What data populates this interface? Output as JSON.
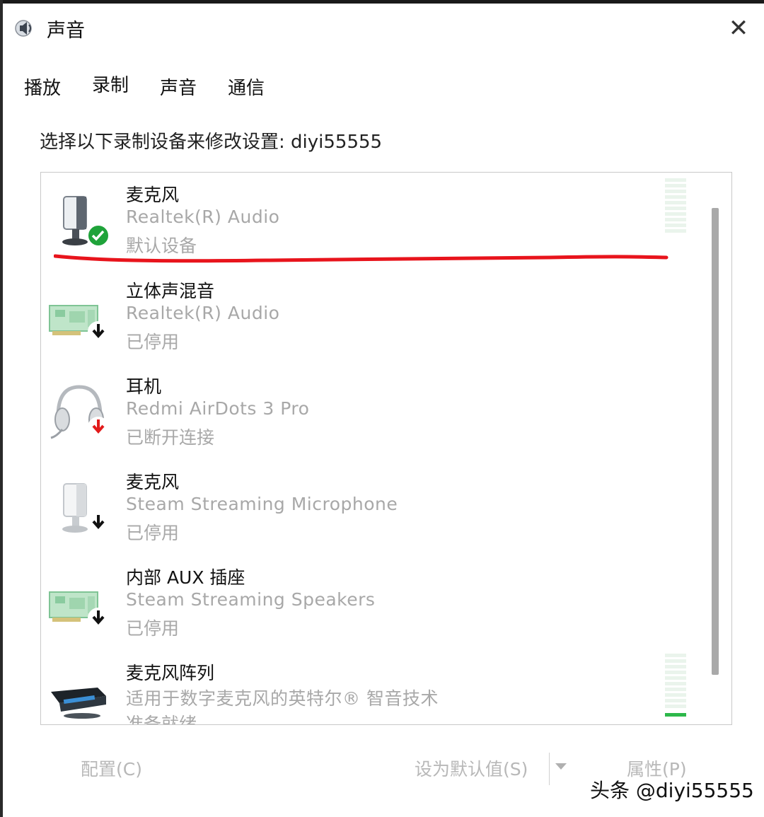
{
  "window": {
    "title": "声音"
  },
  "tabs": [
    {
      "label": "播放"
    },
    {
      "label": "录制"
    },
    {
      "label": "声音"
    },
    {
      "label": "通信"
    }
  ],
  "instruction": "选择以下录制设备来修改设置: diyi55555",
  "devices": [
    {
      "name": "麦克风",
      "driver": "Realtek(R) Audio",
      "status": "默认设备",
      "icon": "microphone-icon",
      "badge": "default-check-icon"
    },
    {
      "name": "立体声混音",
      "driver": "Realtek(R) Audio",
      "status": "已停用",
      "icon": "sound-card-icon",
      "badge": "disabled-arrow-icon"
    },
    {
      "name": "耳机",
      "driver": "Redmi AirDots 3 Pro",
      "status": "已断开连接",
      "icon": "headset-icon",
      "badge": "disconnected-arrow-icon"
    },
    {
      "name": "麦克风",
      "driver": "Steam Streaming Microphone",
      "status": "已停用",
      "icon": "microphone-icon",
      "badge": "disabled-arrow-icon"
    },
    {
      "name": "内部 AUX 插座",
      "driver": "Steam Streaming Speakers",
      "status": "已停用",
      "icon": "sound-card-icon",
      "badge": "disabled-arrow-icon"
    },
    {
      "name": "麦克风阵列",
      "driver": "适用于数字麦克风的英特尔® 智音技术",
      "status": "准备就绪",
      "icon": "mic-array-icon"
    }
  ],
  "buttons": {
    "configure": "配置(C)",
    "set_default": "设为默认值(S)",
    "properties": "属性(P)"
  },
  "watermark": "头条 @diyi55555",
  "colors": {
    "check_green": "#1fa33a",
    "annotation_red": "#e8141c",
    "level_green": "#2db84a",
    "muted_text": "#a8a8a8"
  }
}
